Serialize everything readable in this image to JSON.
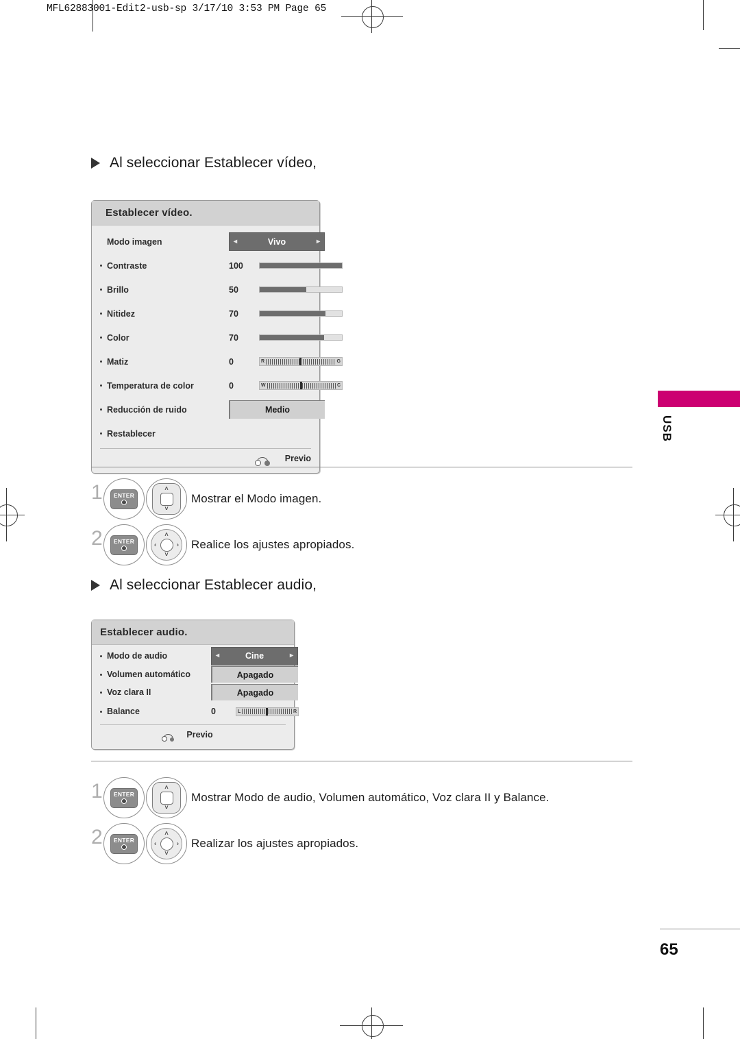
{
  "header": {
    "slug": "MFL62883001-Edit2-usb-sp  3/17/10 3:53 PM  Page 65"
  },
  "side_tab": {
    "label": "USB",
    "accent_color": "#cc0071"
  },
  "page_number": "65",
  "sections": [
    {
      "heading": "Al seleccionar Establecer vídeo,",
      "menu": {
        "title": "Establecer vídeo.",
        "rows": [
          {
            "label": "Modo imagen",
            "bullet": false,
            "control": "select-dark",
            "value": "Vivo"
          },
          {
            "label": "Contraste",
            "bullet": true,
            "control": "bar",
            "number": "100",
            "fill": 100
          },
          {
            "label": "Brillo",
            "bullet": true,
            "control": "bar",
            "number": "50",
            "fill": 57
          },
          {
            "label": "Nitidez",
            "bullet": true,
            "control": "bar",
            "number": "70",
            "fill": 80
          },
          {
            "label": "Color",
            "bullet": true,
            "control": "bar",
            "number": "70",
            "fill": 78
          },
          {
            "label": "Matiz",
            "bullet": true,
            "control": "tick",
            "number": "0",
            "left_end": "R",
            "right_end": "G"
          },
          {
            "label": "Temperatura de color",
            "bullet": true,
            "control": "tick",
            "number": "0",
            "left_end": "W",
            "right_end": "C"
          },
          {
            "label": "Reducción de ruido",
            "bullet": true,
            "control": "select-light",
            "value": "Medio"
          },
          {
            "label": "Restablecer",
            "bullet": true,
            "control": "none"
          }
        ],
        "footer": "Previo"
      },
      "steps": [
        {
          "num": "1",
          "keys": [
            "enter",
            "updown"
          ],
          "text": "Mostrar el Modo imagen."
        },
        {
          "num": "2",
          "keys": [
            "enter",
            "fourway"
          ],
          "text": "Realice los ajustes apropiados."
        }
      ]
    },
    {
      "heading": "Al seleccionar Establecer audio,",
      "menu": {
        "title": "Establecer audio.",
        "rows": [
          {
            "label": "Modo de audio",
            "bullet": true,
            "control": "select-dark",
            "value": "Cine"
          },
          {
            "label": "Volumen automático",
            "bullet": true,
            "control": "select-light",
            "value": "Apagado"
          },
          {
            "label": "Voz clara II",
            "bullet": true,
            "control": "select-light",
            "value": "Apagado"
          },
          {
            "label": "Balance",
            "bullet": true,
            "control": "tick",
            "number": "0",
            "left_end": "L",
            "right_end": "R"
          }
        ],
        "footer": "Previo"
      },
      "steps": [
        {
          "num": "1",
          "keys": [
            "enter",
            "updown"
          ],
          "text": "Mostrar Modo de audio, Volumen automático, Voz clara II y Balance."
        },
        {
          "num": "2",
          "keys": [
            "enter",
            "fourway"
          ],
          "text": "Realizar los ajustes apropiados."
        }
      ]
    }
  ],
  "icons": {
    "enter_label": "ENTER",
    "chevron_up": "˄",
    "chevron_down": "˅",
    "chevron_left": "‹",
    "chevron_right": "›",
    "arrow_left": "◂",
    "arrow_right": "▸"
  }
}
